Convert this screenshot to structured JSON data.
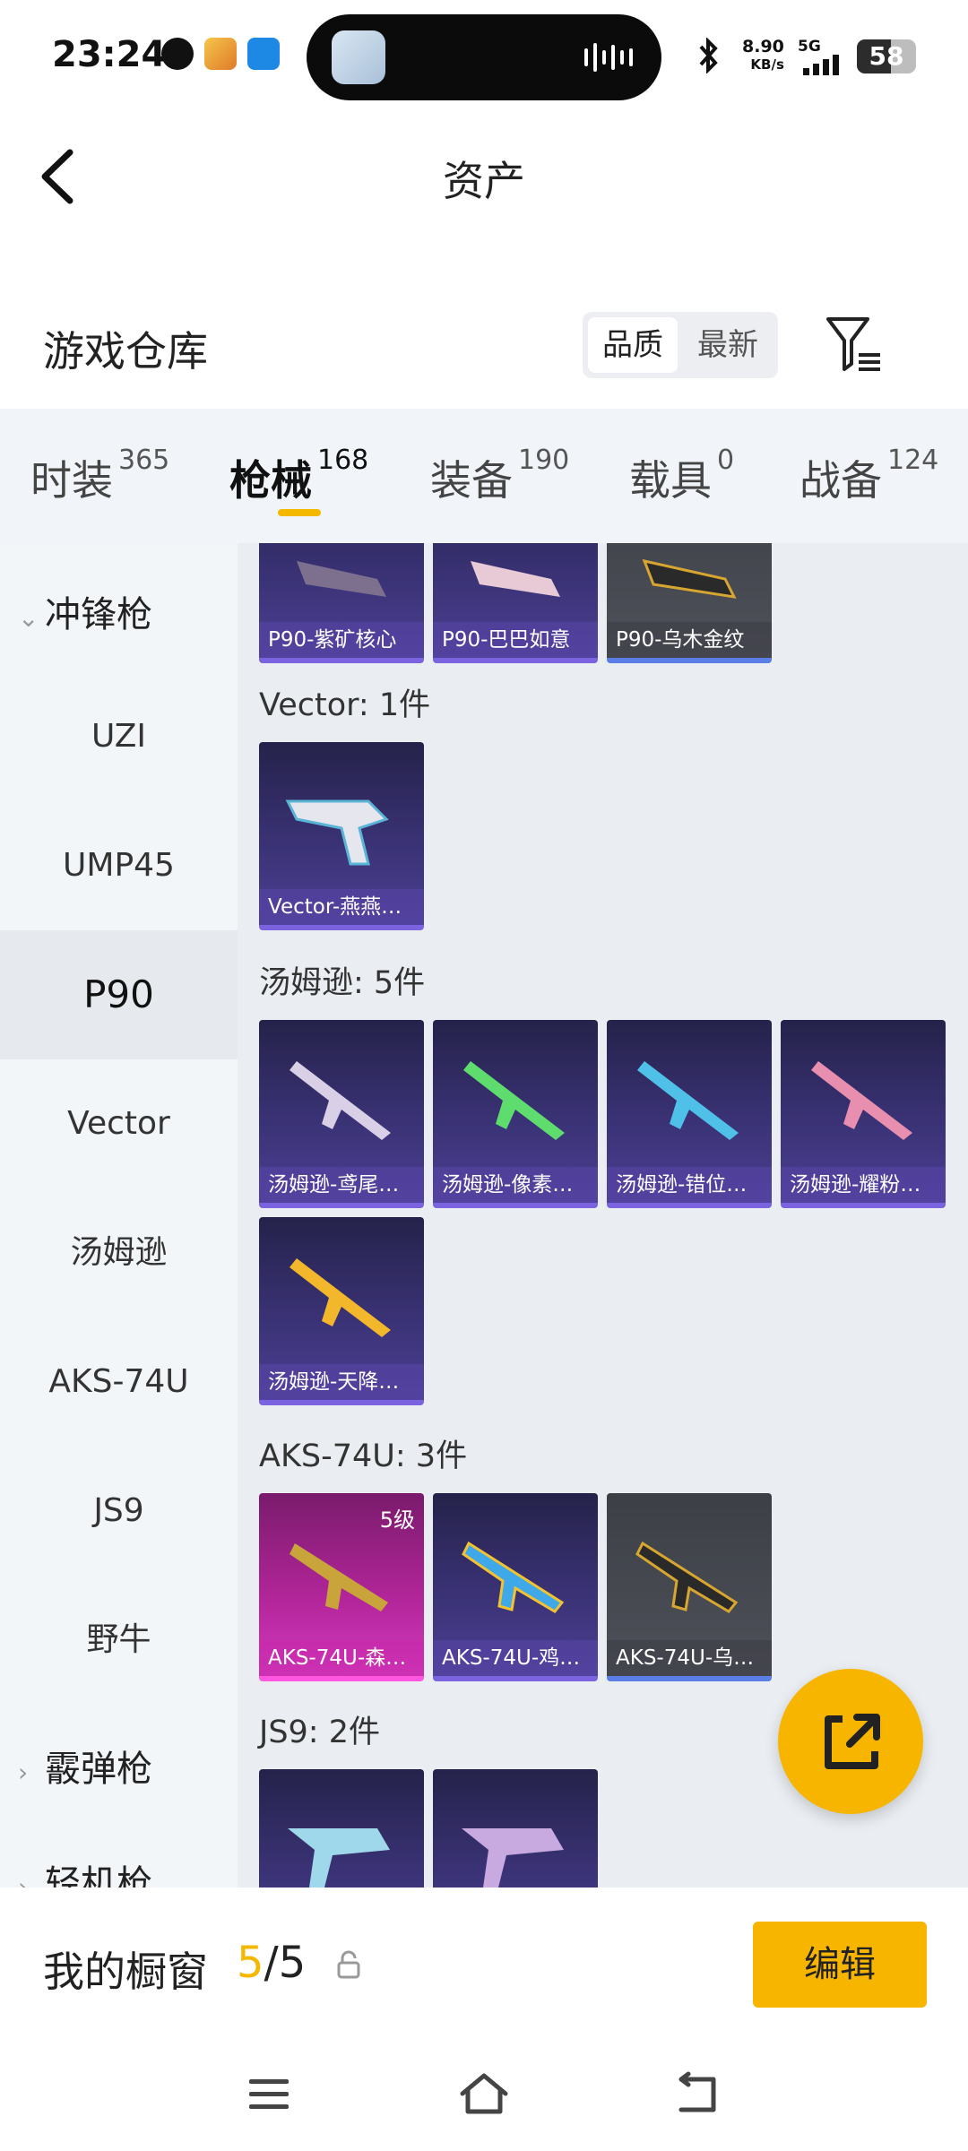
{
  "status_bar": {
    "time": "23:24",
    "net_speed_value": "8.90",
    "net_speed_unit": "KB/s",
    "network": "5G",
    "battery": "58"
  },
  "header": {
    "title": "资产"
  },
  "warehouse": {
    "title": "游戏仓库",
    "sort_options": [
      "品质",
      "最新"
    ],
    "active_sort": "品质"
  },
  "tabs": [
    {
      "label": "时装",
      "count": "365"
    },
    {
      "label": "枪械",
      "count": "168",
      "active": true
    },
    {
      "label": "装备",
      "count": "190"
    },
    {
      "label": "载具",
      "count": "0"
    },
    {
      "label": "战备",
      "count": "124"
    }
  ],
  "sidebar": {
    "group_smg": "冲锋枪",
    "items": [
      "UZI",
      "UMP45",
      "P90",
      "Vector",
      "汤姆逊",
      "AKS-74U",
      "JS9",
      "野牛"
    ],
    "active_item": "P90",
    "group_shotgun": "霰弹枪",
    "group_partial": "轻机枪"
  },
  "content": {
    "p90_cards": [
      "P90-紫矿核心",
      "P90-巴巴如意",
      "P90-乌木金纹"
    ],
    "vector": {
      "label": "Vector: 1件",
      "cards": [
        "Vector-燕燕…"
      ]
    },
    "thompson": {
      "label": "汤姆逊: 5件",
      "cards": [
        "汤姆逊-鸢尾…",
        "汤姆逊-像素…",
        "汤姆逊-错位…",
        "汤姆逊-耀粉…",
        "汤姆逊-天降…"
      ]
    },
    "aks": {
      "label": "AKS-74U: 3件",
      "cards": [
        "AKS-74U-森…",
        "AKS-74U-鸡…",
        "AKS-74U-乌…"
      ],
      "level": "5级"
    },
    "js9": {
      "label": "JS9: 2件"
    }
  },
  "bottom": {
    "showcase_label": "我的橱窗",
    "showcase_current": "5",
    "showcase_total": "/5",
    "edit_label": "编辑"
  },
  "colors": {
    "accent": "#f7b500",
    "card_purple": "#3a3275",
    "card_gray": "#4e5159",
    "card_pink": "#b4269b"
  }
}
